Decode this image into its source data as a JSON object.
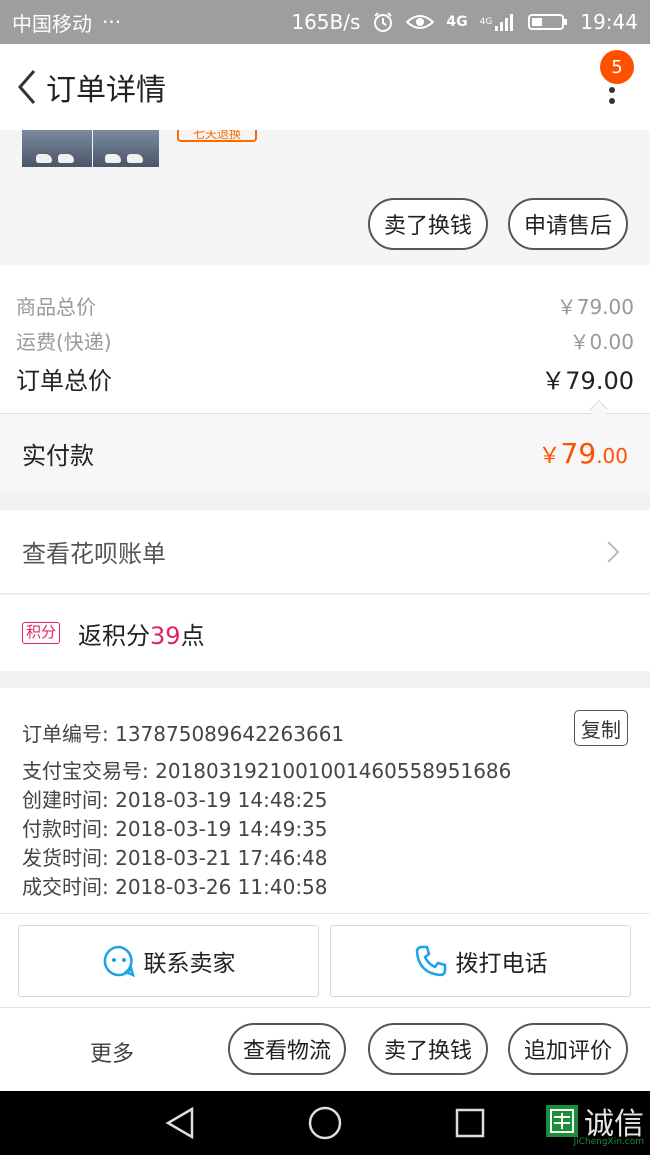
{
  "status_bar": {
    "carrier": "中国移动",
    "dots": "···",
    "speed": "165B/s",
    "network": "4G",
    "network2": "4G",
    "time": "19:44"
  },
  "nav": {
    "title": "订单详情",
    "badge": "5"
  },
  "product": {
    "tag": "七天退换",
    "actions": [
      "卖了换钱",
      "申请售后"
    ]
  },
  "price": {
    "goods_label": "商品总价",
    "goods_value": "￥79.00",
    "shipping_label": "运费(快递)",
    "shipping_value": "￥0.00",
    "total_label": "订单总价",
    "total_value": "￥79.00"
  },
  "paid": {
    "label": "实付款",
    "symbol": "￥",
    "integer": "79",
    "decimal": ".00"
  },
  "huabei": {
    "label": "查看花呗账单"
  },
  "points": {
    "badge": "积分",
    "prefix": "返积分",
    "number": "39",
    "suffix": "点"
  },
  "order_info": {
    "order_no": "订单编号: 137875089642263661",
    "copy_label": "复制",
    "alipay_no": "支付宝交易号: 2018031921001001460558951686",
    "created": "创建时间: 2018-03-19 14:48:25",
    "paid_time": "付款时间: 2018-03-19 14:49:35",
    "shipped": "发货时间: 2018-03-21 17:46:48",
    "completed": "成交时间: 2018-03-26 11:40:58"
  },
  "contact": {
    "seller": "联系卖家",
    "phone": "拨打电话"
  },
  "bottom": {
    "more": "更多",
    "logistics": "查看物流",
    "resell": "卖了换钱",
    "review": "追加评价"
  },
  "watermark": {
    "text": "诚信",
    "url": "JiChengXin.com"
  },
  "colors": {
    "accent": "#ff5000",
    "points": "#e0245e",
    "chat_icon": "#1aa3e8"
  }
}
